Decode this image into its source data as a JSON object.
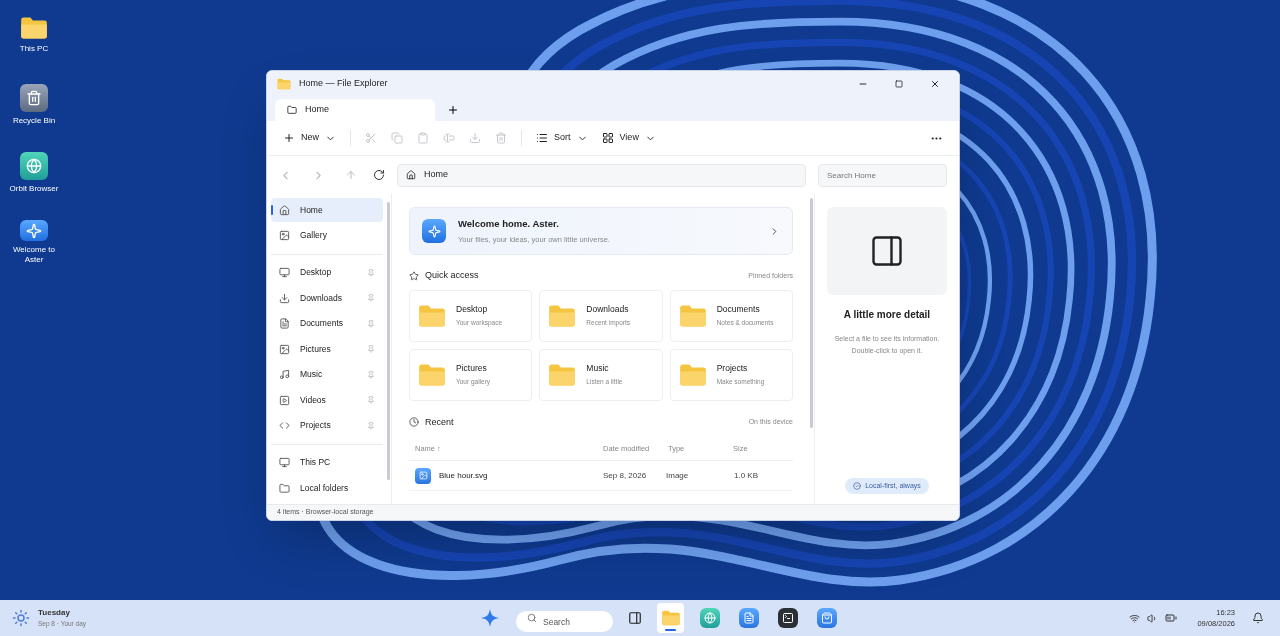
{
  "desktop_icons": [
    {
      "kind": "folder",
      "label": "This PC"
    },
    {
      "kind": "recycle",
      "label": "Recycle Bin"
    },
    {
      "kind": "browser",
      "label": "Orbit Browser"
    },
    {
      "kind": "welcome",
      "label": "Welcome to Aster"
    }
  ],
  "window": {
    "title": "Home — File Explorer",
    "tabs": [
      {
        "label": "Home",
        "selected": true
      }
    ],
    "toolbar": {
      "new_label": "New",
      "actions": [
        {
          "kind": "cut",
          "disabled": true
        },
        {
          "kind": "copy",
          "disabled": true
        },
        {
          "kind": "paste",
          "disabled": true
        },
        {
          "kind": "rename",
          "disabled": true
        },
        {
          "kind": "download",
          "disabled": true
        },
        {
          "kind": "delete",
          "disabled": true
        }
      ],
      "sort_label": "Sort",
      "view_label": "View"
    },
    "address": "Home",
    "search": {
      "placeholder": "Search Home"
    },
    "sidebar": {
      "groups": [
        [
          {
            "kind": "home",
            "label": "Home",
            "selected": true,
            "pinned": false
          },
          {
            "kind": "gallery",
            "label": "Gallery",
            "selected": false,
            "pinned": false
          }
        ],
        [
          {
            "kind": "desktop",
            "label": "Desktop",
            "selected": false,
            "pinned": true
          },
          {
            "kind": "downloads",
            "label": "Downloads",
            "selected": false,
            "pinned": true
          },
          {
            "kind": "documents",
            "label": "Documents",
            "selected": false,
            "pinned": true
          },
          {
            "kind": "pictures",
            "label": "Pictures",
            "selected": false,
            "pinned": true
          },
          {
            "kind": "music",
            "label": "Music",
            "selected": false,
            "pinned": true
          },
          {
            "kind": "videos",
            "label": "Videos",
            "selected": false,
            "pinned": true
          },
          {
            "kind": "projects",
            "label": "Projects",
            "selected": false,
            "pinned": true
          }
        ],
        [
          {
            "kind": "pc",
            "label": "This PC",
            "selected": false,
            "pinned": false
          },
          {
            "kind": "folder",
            "label": "Local folders",
            "selected": false,
            "pinned": false
          }
        ]
      ]
    },
    "welcome": {
      "title": "Welcome home. Aster.",
      "subtitle": "Your files, your ideas, your own little universe."
    },
    "quick_access": {
      "title": "Quick access",
      "note": "Pinned folders",
      "folders": [
        {
          "name": "Desktop",
          "detail": "Your workspace"
        },
        {
          "name": "Downloads",
          "detail": "Recent imports"
        },
        {
          "name": "Documents",
          "detail": "Notes & documents"
        },
        {
          "name": "Pictures",
          "detail": "Your gallery"
        },
        {
          "name": "Music",
          "detail": "Listen a little"
        },
        {
          "name": "Projects",
          "detail": "Make something"
        }
      ]
    },
    "recent": {
      "title": "Recent",
      "note": "On this device",
      "columns": [
        "Name ↑",
        "Date modified",
        "Type",
        "Size"
      ],
      "rows": [
        {
          "cells": [
            "Blue hour.svg",
            "Sep 8, 2026",
            "Image",
            "1.0 KB"
          ]
        }
      ]
    },
    "details": {
      "title": "A little more detail",
      "text": "Select a file to see its information. Double-click to open it.",
      "badge": "Local-first, always"
    },
    "status_bar": "4 items · Browser-local storage"
  },
  "taskbar": {
    "weather": {
      "day": "Tuesday",
      "detail": "Sep 8 · Your day"
    },
    "search": {
      "placeholder": "Search"
    },
    "apps": [
      {
        "kind": "explorer",
        "selected": true
      },
      {
        "kind": "browser",
        "selected": false
      },
      {
        "kind": "notes",
        "selected": false
      },
      {
        "kind": "terminal",
        "selected": false
      },
      {
        "kind": "store",
        "selected": false
      }
    ],
    "time": "16:23",
    "date": "09/08/2026"
  }
}
